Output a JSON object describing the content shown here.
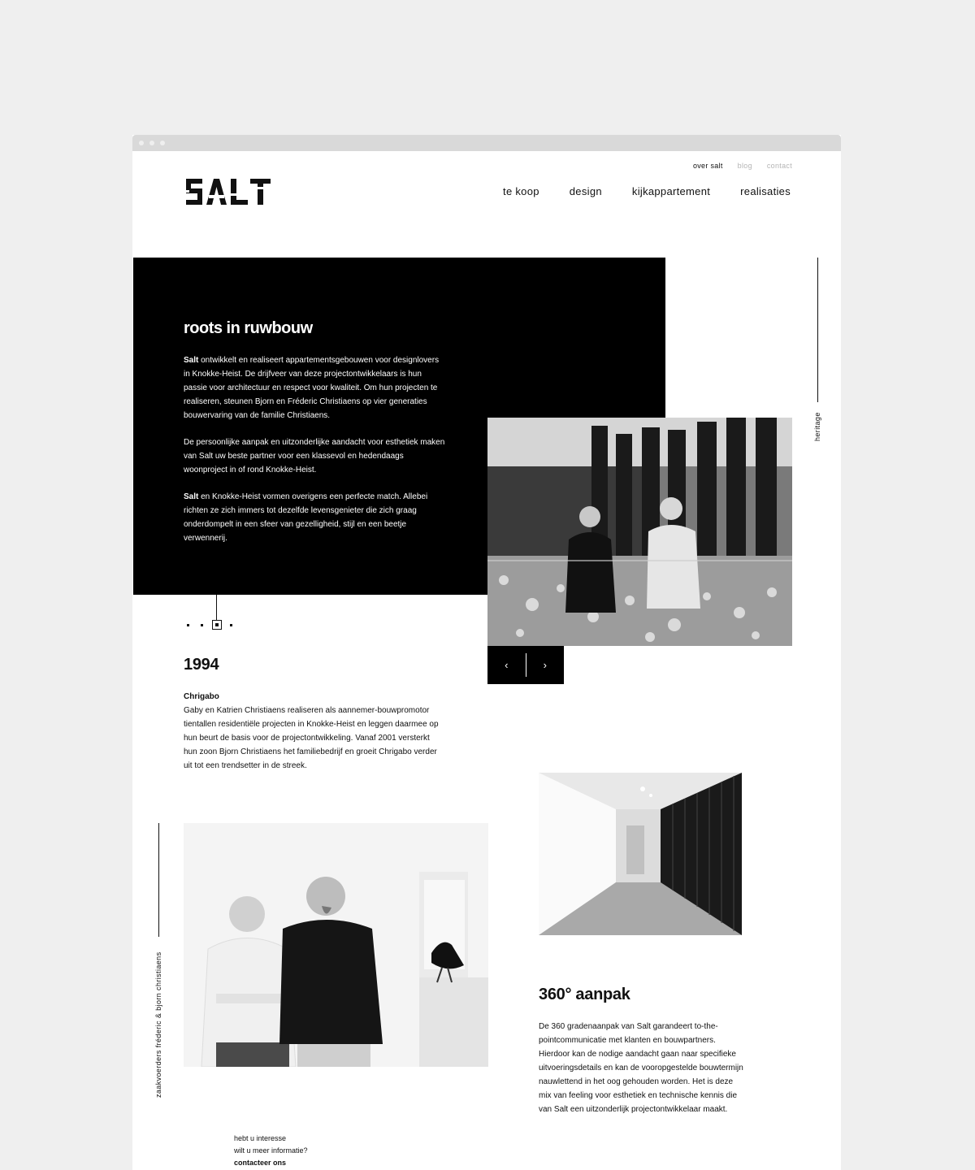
{
  "window": {
    "chrome_dots": 3
  },
  "brand": {
    "logo_text": "SALT"
  },
  "top_nav": [
    {
      "label": "over salt",
      "active": true
    },
    {
      "label": "blog",
      "active": false
    },
    {
      "label": "contact",
      "active": false
    }
  ],
  "main_nav": [
    {
      "label": "te koop"
    },
    {
      "label": "design"
    },
    {
      "label": "kijkappartement"
    },
    {
      "label": "realisaties"
    }
  ],
  "hero": {
    "title": "roots in ruwbouw",
    "p1_lead": "Salt",
    "p1_rest": " ontwikkelt en realiseert appartementsgebouwen voor designlovers in Knokke-Heist. De drijfveer van deze projectontwikkelaars is hun passie voor architectuur en respect voor kwaliteit. Om hun projecten te realiseren, steunen Bjorn en Fréderic Christiaens op vier generaties bouwervaring van de familie Christiaens.",
    "p2": "De persoonlijke aanpak en uitzonderlijke aandacht voor esthetiek maken van Salt uw beste partner voor een klassevol en hedendaags woonproject in of rond Knokke-Heist.",
    "p3_lead": "Salt",
    "p3_rest": " en Knokke-Heist vormen overigens een perfecte match. Allebei richten ze zich immers tot dezelfde levensgenieter die zich graag onderdompelt in een sfeer van gezelligheid, stijl en een beetje verwennerij."
  },
  "side_labels": {
    "right": "heritage",
    "left": "zaakvoerders fréderic & bjorn christiaens"
  },
  "slider": {
    "prev_icon": "‹",
    "next_icon": "›"
  },
  "timeline": {
    "active_index": 2,
    "year": "1994",
    "entry_title": "Chrigabo",
    "entry_text": "Gaby en Katrien Christiaens realiseren als aannemer-bouwpromotor tientallen residentiële projecten in Knokke-Heist en leggen daarmee op hun beurt de basis voor de projectontwikkeling. Vanaf 2001 versterkt hun zoon Bjorn Christiaens het familiebedrijf en groeit Chrigabo verder uit tot een trendsetter in de streek."
  },
  "approach": {
    "title": "360° aanpak",
    "text": "De 360 gradenaanpak van Salt garandeert to-the-pointcommunicatie met klanten en bouwpartners. Hierdoor kan de nodige aandacht gaan naar specifieke uitvoeringsdetails en kan de vooropgestelde bouwtermijn nauwlettend in het oog gehouden worden. Het is deze mix van feeling voor esthetiek en technische kennis die van Salt een uitzonderlijk projectontwikkelaar maakt."
  },
  "cta": {
    "line1": "hebt u interesse",
    "line2": "wilt u meer informatie?",
    "link": "contacteer ons"
  }
}
